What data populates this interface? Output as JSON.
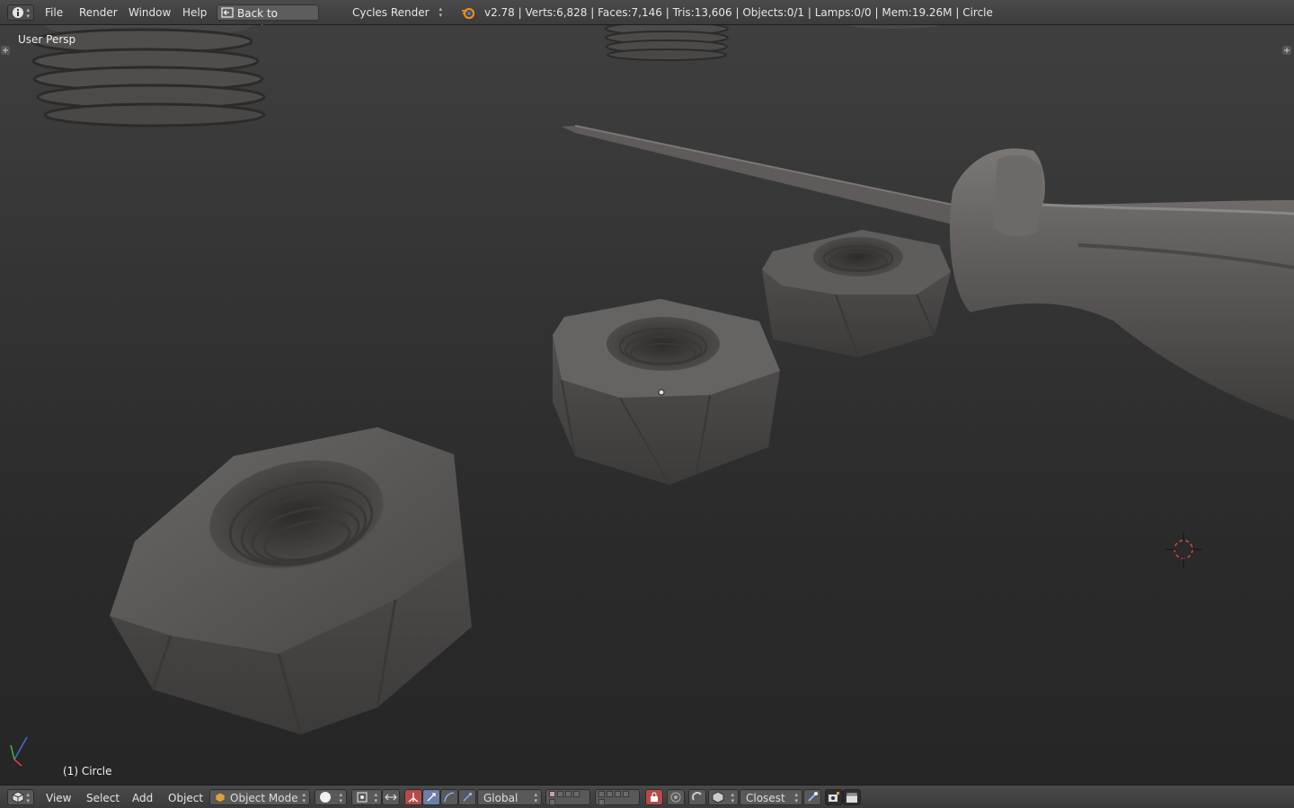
{
  "header": {
    "menus": [
      "File",
      "Render",
      "Window",
      "Help"
    ],
    "back_button": "Back to Previous",
    "render_engine": "Cycles Render",
    "stats": "v2.78 | Verts:6,828 | Faces:7,146 | Tris:13,606 | Objects:0/1 | Lamps:0/0 | Mem:19.26M | Circle"
  },
  "viewport": {
    "view_name": "User Persp",
    "active_object": "(1) Circle"
  },
  "footer": {
    "menus": [
      "View",
      "Select",
      "Add",
      "Object"
    ],
    "mode": "Object Mode",
    "orientation": "Global",
    "snap_target": "Closest"
  },
  "colors": {
    "header_bg": "#424242",
    "viewport_top": "#3f3f3f",
    "viewport_bottom": "#262626",
    "active_button": "#6e7fa6",
    "cursor_red": "#e04040"
  }
}
